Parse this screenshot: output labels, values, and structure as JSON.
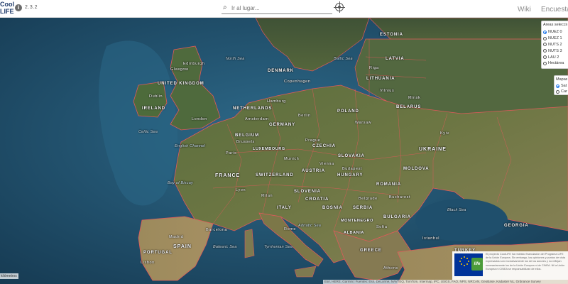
{
  "app": {
    "logo_line1": "Cool",
    "logo_line2": "LIFE",
    "version": "2.3.2"
  },
  "search": {
    "placeholder": "Ir al lugar..."
  },
  "nav": {
    "wiki": "Wiki",
    "encuesta": "Encuesta"
  },
  "areas_panel": {
    "title": "Áreas seleccio",
    "options": [
      "NUEZ 0",
      "NUEZ 1",
      "NUTS 2",
      "NUTS 3",
      "LAU 2",
      "Hectárea"
    ],
    "selected": "NUEZ 0"
  },
  "maps_panel": {
    "title": "Mapas",
    "options": [
      "Sat",
      "Car"
    ],
    "selected": "Sat"
  },
  "map": {
    "countries": [
      {
        "name": "ESTONIA"
      },
      {
        "name": "LATVIA"
      },
      {
        "name": "LITHUANIA"
      },
      {
        "name": "BELARUS"
      },
      {
        "name": "DENMARK"
      },
      {
        "name": "UNITED KINGDOM"
      },
      {
        "name": "IRELAND"
      },
      {
        "name": "NETHERLANDS"
      },
      {
        "name": "BELGIUM"
      },
      {
        "name": "GERMANY"
      },
      {
        "name": "POLAND"
      },
      {
        "name": "CZECHIA"
      },
      {
        "name": "SLOVAKIA"
      },
      {
        "name": "UKRAINE"
      },
      {
        "name": "FRANCE"
      },
      {
        "name": "SWITZERLAND"
      },
      {
        "name": "AUSTRIA"
      },
      {
        "name": "HUNGARY"
      },
      {
        "name": "MOLDOVA"
      },
      {
        "name": "ROMANIA"
      },
      {
        "name": "SLOVENIA"
      },
      {
        "name": "CROATIA"
      },
      {
        "name": "SERBIA"
      },
      {
        "name": "BOSNIA"
      },
      {
        "name": "BULGARIA"
      },
      {
        "name": "ITALY"
      },
      {
        "name": "SPAIN"
      },
      {
        "name": "PORTUGAL"
      },
      {
        "name": "GREECE"
      },
      {
        "name": "TURKEY"
      },
      {
        "name": "GEORGIA"
      },
      {
        "name": "LUXEMBOURG"
      },
      {
        "name": "MONTENEGRO"
      },
      {
        "name": "ALBANIA"
      }
    ],
    "seas": [
      {
        "name": "North Sea"
      },
      {
        "name": "Baltic Sea"
      },
      {
        "name": "Black Sea"
      },
      {
        "name": "Celtic Sea"
      },
      {
        "name": "English Channel"
      },
      {
        "name": "Bay of Biscay"
      },
      {
        "name": "Tyrrhenian Sea"
      },
      {
        "name": "Adriatic Sea"
      },
      {
        "name": "Balearic Sea"
      }
    ],
    "places": [
      {
        "name": "Edinburgh"
      },
      {
        "name": "Glasgow"
      },
      {
        "name": "London"
      },
      {
        "name": "Dublin"
      },
      {
        "name": "Paris"
      },
      {
        "name": "Berlin"
      },
      {
        "name": "Hamburg"
      },
      {
        "name": "Warsaw"
      },
      {
        "name": "Prague"
      },
      {
        "name": "Vienna"
      },
      {
        "name": "Budapest"
      },
      {
        "name": "Kyiv"
      },
      {
        "name": "Bucharest"
      },
      {
        "name": "Madrid"
      },
      {
        "name": "Barcelona"
      },
      {
        "name": "Rome"
      },
      {
        "name": "Milan"
      },
      {
        "name": "Riga"
      },
      {
        "name": "Vilnius"
      },
      {
        "name": "Minsk"
      },
      {
        "name": "Copenhagen"
      },
      {
        "name": "Amsterdam"
      },
      {
        "name": "Brussels"
      },
      {
        "name": "Munich"
      },
      {
        "name": "Sofia"
      },
      {
        "name": "Belgrade"
      },
      {
        "name": "Lyon"
      },
      {
        "name": "Lisbon"
      },
      {
        "name": "Athens"
      },
      {
        "name": "Istanbul"
      }
    ]
  },
  "scale_label": "kilómetros",
  "attribution": "Esri, HERE, Garmin | Fuentes: Esri, DeLorme, NAVTEQ, TomTom, Intermap, iPC, USGS, FAO, NPS, NRCAN, GeoBase, Kadaster NL, Ordnance Survey",
  "eu_notice": {
    "life_label": "life",
    "text": "El proyecto CoolLIFE ha recibido financiación del Programa LIFE de la Unión Europea. Sin embargo, las opiniones y puntos de vista expresados son exclusivamente los de los autores y no reflejan necesariamente los de la Unión Europea ni de CINEA. Ni la Unión Europea ni CINEA se responsabilizan de ellos."
  }
}
